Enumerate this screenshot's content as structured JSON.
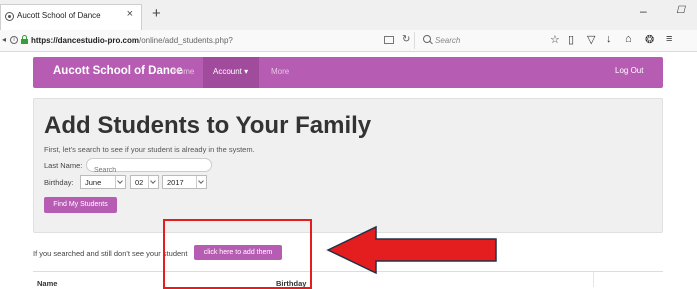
{
  "browser": {
    "tab_title": "Aucott School of Dance",
    "tab_close": "×",
    "new_tab": "+",
    "url_host": "https://dancestudio-pro.com",
    "url_path": "/online/add_students.php?",
    "search_placeholder": "Search",
    "window_min": "–",
    "window_max": "☐"
  },
  "site_nav": {
    "brand": "Aucott School of Dance",
    "home": "Home",
    "account": "Account ▾",
    "more": "More",
    "logout": "Log Out"
  },
  "page": {
    "title": "Add Students to Your Family",
    "lead": "First, let's search to see if your student is already in the system.",
    "last_name_label": "Last Name:",
    "search_placeholder": "Search",
    "birthday_label": "Birthday:",
    "month": "June",
    "day": "02",
    "year": "2017",
    "find_button": "Find My Students",
    "hint": "If you searched and still don't see your student",
    "add_button": "click here to add them"
  },
  "table": {
    "headers": [
      "Name",
      "Birthday"
    ]
  },
  "colors": {
    "brand_purple": "#b75cb3",
    "annotation_red": "#e41e1e"
  }
}
